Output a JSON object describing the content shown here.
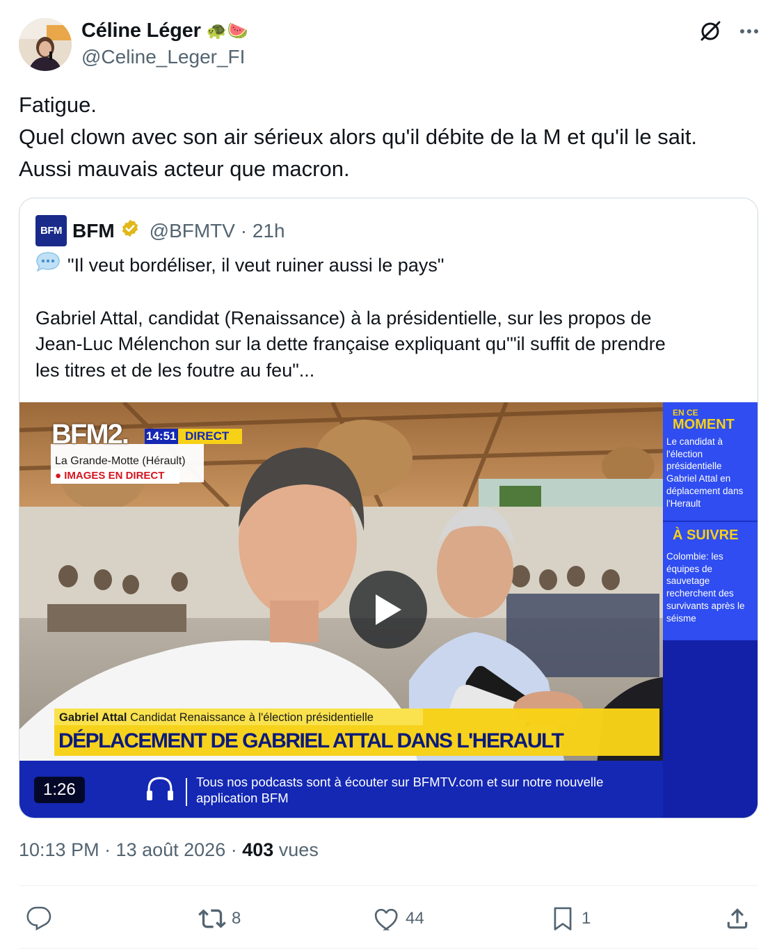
{
  "author": {
    "display_name": "Céline Léger",
    "emojis": "🐢🍉",
    "handle": "@Celine_Leger_FI"
  },
  "tweet": {
    "lines": [
      "Fatigue.",
      "Quel clown avec son air sérieux alors qu'il débite de la M et qu'il le sait.",
      "Aussi mauvais acteur que macron."
    ]
  },
  "quote": {
    "logo_text": "BFM",
    "name": "BFM",
    "handle_time": "@BFMTV · 21h",
    "first_line": "\"Il veut bordéliser, il veut ruiner aussi le pays\"",
    "body_lines": [
      "Gabriel Attal, candidat (Renaissance) à la présidentielle, sur les propos de",
      "Jean-Luc Mélenchon sur la dette française expliquant qu'\"il suffit de prendre",
      "les titres et de les foutre au feu\"..."
    ]
  },
  "video": {
    "duration": "1:26",
    "channel": "BFM2.",
    "time": "14:51",
    "live_label": "DIRECT",
    "location": "La Grande-Motte (Hérault)",
    "live_images": "● IMAGES EN DIRECT",
    "side_moment_small": "EN CE",
    "side_moment_title": "MOMENT",
    "side_moment_text": [
      "Le candidat à",
      "l'élection",
      "présidentielle",
      "Gabriel Attal en",
      "déplacement dans",
      "l'Herault"
    ],
    "side_next_title": "À SUIVRE",
    "side_next_text": [
      "Colombie: les",
      "équipes de",
      "sauvetage",
      "recherchent des",
      "survivants après le",
      "séisme"
    ],
    "lower_name": "Gabriel Attal",
    "lower_role": " Candidat Renaissance à l'élection présidentielle",
    "headline": "DÉPLACEMENT DE GABRIEL ATTAL DANS L'HERAULT",
    "ticker_line1": "Tous nos podcasts sont à écouter sur BFMTV.com et sur notre nouvelle",
    "ticker_line2": "application BFM"
  },
  "meta": {
    "timestamp": "10:13 PM · 13 août 2026 · ",
    "views_count": "403",
    "views_label": " vues"
  },
  "actions": {
    "reply_count": "",
    "retweet_count": "8",
    "like_count": "44",
    "bookmark_count": "1"
  },
  "colors": {
    "verified_gold": "#e2b719",
    "bfm_blue": "#1428b4",
    "bfm_yellow": "#f7d117",
    "text_secondary": "#536471"
  }
}
